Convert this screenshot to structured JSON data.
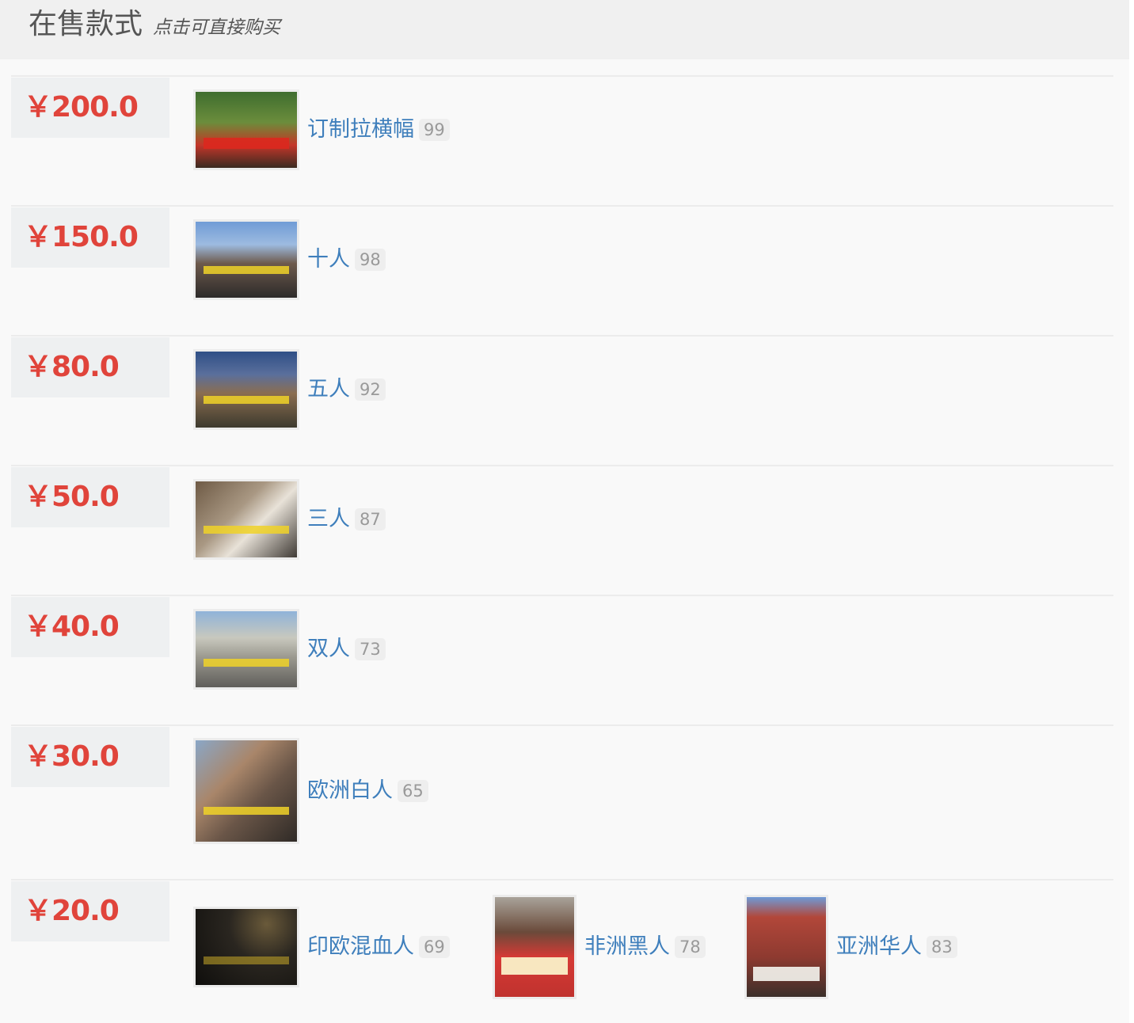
{
  "header": {
    "title": "在售款式",
    "subtitle": "点击可直接购买"
  },
  "rows": [
    {
      "price": "￥200.0",
      "items": [
        {
          "name": "订制拉横幅",
          "count": "99"
        }
      ]
    },
    {
      "price": "￥150.0",
      "items": [
        {
          "name": "十人",
          "count": "98"
        }
      ]
    },
    {
      "price": "￥80.0",
      "items": [
        {
          "name": "五人",
          "count": "92"
        }
      ]
    },
    {
      "price": "￥50.0",
      "items": [
        {
          "name": "三人",
          "count": "87"
        }
      ]
    },
    {
      "price": "￥40.0",
      "items": [
        {
          "name": "双人",
          "count": "73"
        }
      ]
    },
    {
      "price": "￥30.0",
      "items": [
        {
          "name": "欧洲白人",
          "count": "65"
        }
      ]
    },
    {
      "price": "￥20.0",
      "items": [
        {
          "name": "印欧混血人",
          "count": "69"
        },
        {
          "name": "非洲黑人",
          "count": "78"
        },
        {
          "name": "亚洲华人",
          "count": "83"
        }
      ]
    }
  ],
  "colors": {
    "price": "#e0443b",
    "link": "#3f7fbc",
    "header_bg": "#f0f0f0",
    "panel_bg": "#f9f9f9"
  }
}
